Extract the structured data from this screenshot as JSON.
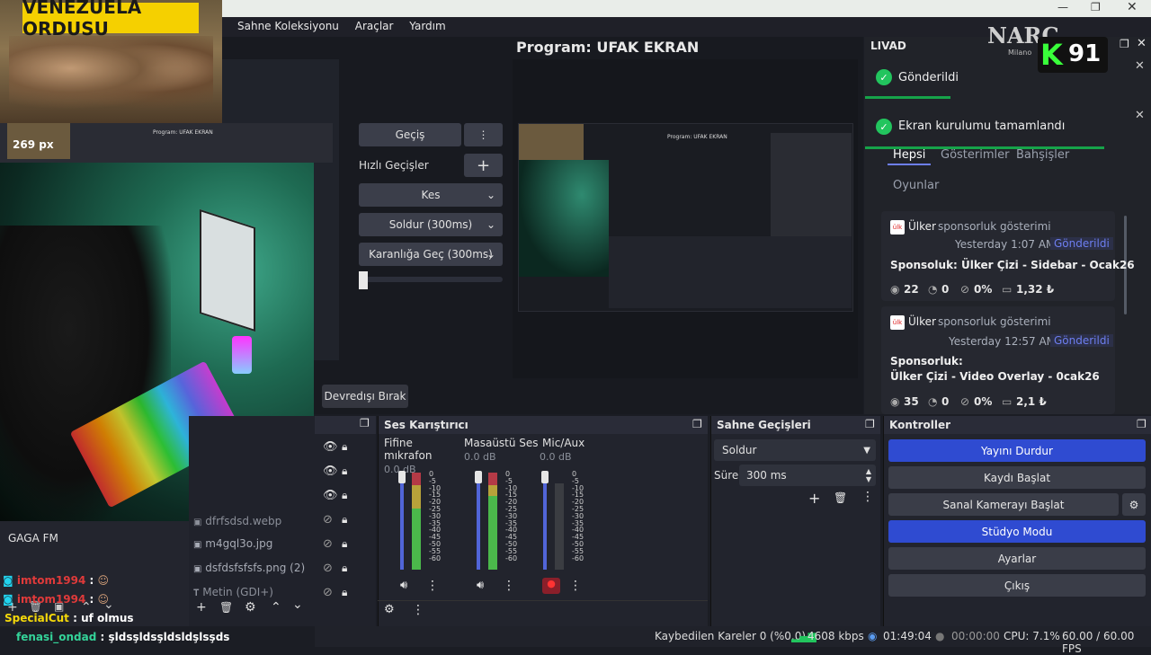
{
  "menu": [
    "Sahne Koleksiyonu",
    "Araçlar",
    "Yardım"
  ],
  "program_title": "Program: UFAK EKRAN",
  "thumbnail_banner": "VENEZUELA ORDUSU",
  "inner_preview": {
    "resolution_badge": "269 px",
    "program_title": "Program: UFAK EKRAN"
  },
  "logo": {
    "top": "NARC",
    "sub": "Milano",
    "mark": "K",
    "number": "91"
  },
  "transitions": {
    "gecis": "Geçiş",
    "hizli_label": "Hızlı Geçişler",
    "options": [
      "Kes",
      "Soldur (300ms)",
      "Karanlığa Geç (300ms)"
    ],
    "disable": "Devredışı Bırak"
  },
  "livad": {
    "title": "LIVAD",
    "toasts": [
      "Gönderildi",
      "Ekran kurulumu tamamlandı"
    ],
    "tabs": [
      "Hepsi",
      "Gösterimler",
      "Bahşişler",
      "Oyunlar"
    ],
    "cards": [
      {
        "brand": "Ülker",
        "kind": "sponsorluk gösterimi",
        "time": "Yesterday 1:07 AM",
        "status": "Gönderildi",
        "title": "Sponsoluk: Ülker Çizi - Sidebar - Ocak26",
        "views": "22",
        "clicks": "0",
        "rate": "0%",
        "amount": "1,32 ₺"
      },
      {
        "brand": "Ülker",
        "kind": "sponsorluk gösterimi",
        "time": "Yesterday 12:57 AM",
        "status": "Gönderildi",
        "title": "Sponsorluk:",
        "title2": "Ülker Çizi - Video Overlay - 0cak26",
        "views": "35",
        "clicks": "0",
        "rate": "0%",
        "amount": "2,1 ₺"
      }
    ]
  },
  "sources": {
    "items": [
      "dfrfsdsd.webp",
      "m4gql3o.jpg",
      "dsfdsfsfsfs.png (2)",
      "Metin (GDI+)"
    ],
    "gaga": "GAGA FM"
  },
  "mixer": {
    "title": "Ses Karıştırıcı",
    "channels": [
      {
        "name": "Fifine mıkrafon",
        "db": "0.0 dB"
      },
      {
        "name": "Masaüstü Ses",
        "db": "0.0 dB"
      },
      {
        "name": "Mic/Aux",
        "db": "0.0 dB"
      }
    ],
    "ticks": [
      "0",
      "-5",
      "-10",
      "-15",
      "-20",
      "-25",
      "-30",
      "-35",
      "-40",
      "-45",
      "-50",
      "-55",
      "-60"
    ]
  },
  "scene_transitions": {
    "title": "Sahne Geçişleri",
    "selected": "Soldur",
    "duration_label": "Süre",
    "duration": "300 ms"
  },
  "controls": {
    "title": "Kontroller",
    "buttons": [
      "Yayını Durdur",
      "Kaydı Başlat",
      "Sanal Kamerayı Başlat",
      "Stüdyo Modu",
      "Ayarlar",
      "Çıkış"
    ]
  },
  "chat": [
    {
      "user": "imtom1994",
      "msg": ":"
    },
    {
      "user": "imtom1994",
      "msg": ":"
    },
    {
      "user": "SpecialCut",
      "msg": ": uf olmus"
    },
    {
      "user": "fenasi_ondad",
      "msg": ": şldsşldsşldsldşlsşds"
    }
  ],
  "status": {
    "dropped": "Kaybedilen Kareler 0 (%0.0)",
    "bitrate": "4608 kbps",
    "live_time": "01:49:04",
    "rec_time": "00:00:00",
    "cpu": "CPU: 7.1%",
    "fps": "60.00 / 60.00 FPS"
  },
  "colors": {
    "accent": "#2f4bd1",
    "success": "#22c55e",
    "toast_bar": "#16a34a",
    "link": "#6d7ef0"
  }
}
